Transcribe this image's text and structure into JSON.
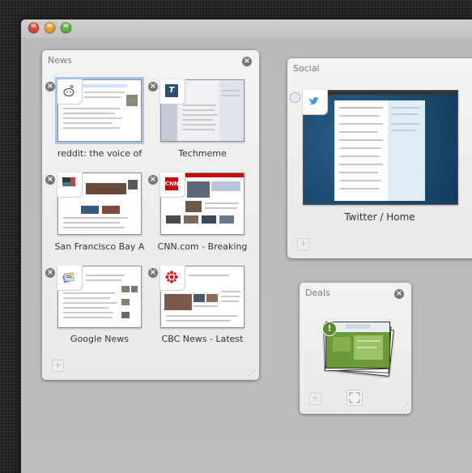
{
  "window": {
    "buttons": [
      "close",
      "minimize",
      "zoom"
    ]
  },
  "groups": {
    "news": {
      "title": "News",
      "tabs": [
        {
          "title": "reddit: the voice of",
          "favicon": "reddit-alien-icon",
          "selected": true
        },
        {
          "title": "Techmeme",
          "favicon": "techmeme-icon"
        },
        {
          "title": "San Francisco Bay A",
          "favicon": "sfgate-icon"
        },
        {
          "title": "CNN.com - Breaking",
          "favicon": "cnn-icon",
          "favicon_text": "CNN"
        },
        {
          "title": "Google News",
          "favicon": "google-news-icon"
        },
        {
          "title": "CBC News - Latest",
          "favicon": "cbc-gem-icon"
        }
      ],
      "new_tab": "+"
    },
    "social": {
      "title": "Social",
      "tabs": [
        {
          "title": "Twitter / Home",
          "favicon": "twitter-bird-icon"
        }
      ],
      "new_tab": "+"
    },
    "deals": {
      "title": "Deals",
      "stack_count": 4,
      "new_tab": "+",
      "expand": "expand-icon"
    }
  },
  "glyphs": {
    "close": "×",
    "resize": "⋰",
    "twitter_t": "t",
    "reddit": "•"
  },
  "colors": {
    "selection": "#a8c4ea",
    "cnn": "#cc0000",
    "twitter": "#3a9ad9",
    "deals_green": "#6b9a3a"
  }
}
